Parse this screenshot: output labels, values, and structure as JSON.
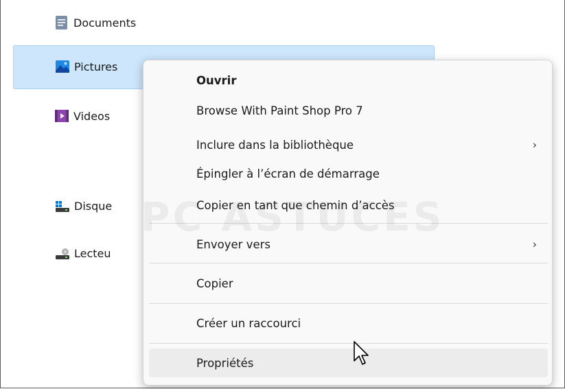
{
  "explorer": {
    "items": [
      {
        "label": "Documents",
        "icon": "documents-icon"
      },
      {
        "label": "Pictures",
        "icon": "pictures-icon"
      },
      {
        "label": "Videos",
        "icon": "videos-icon"
      },
      {
        "label": "Disque",
        "icon": "drive-icon"
      },
      {
        "label": "Lecteu",
        "icon": "removable-drive-icon"
      }
    ]
  },
  "context_menu": {
    "items": [
      {
        "label": "Ouvrir",
        "bold": true
      },
      {
        "label": "Browse With Paint Shop Pro 7"
      },
      {
        "label": "Inclure dans la bibliothèque",
        "submenu": true
      },
      {
        "label": "Épingler à l’écran de démarrage"
      },
      {
        "label": "Copier en tant que chemin d’accès"
      },
      {
        "label": "Envoyer vers",
        "submenu": true
      },
      {
        "label": "Copier"
      },
      {
        "label": "Créer un raccourci"
      },
      {
        "label": "Propriétés",
        "hovered": true
      }
    ]
  },
  "watermark": "PC ASTUCES",
  "colors": {
    "selection": "#cde6fb",
    "selection_border": "#a9d0f5",
    "menu_bg": "#f9f9f9",
    "hover": "#ececec"
  }
}
